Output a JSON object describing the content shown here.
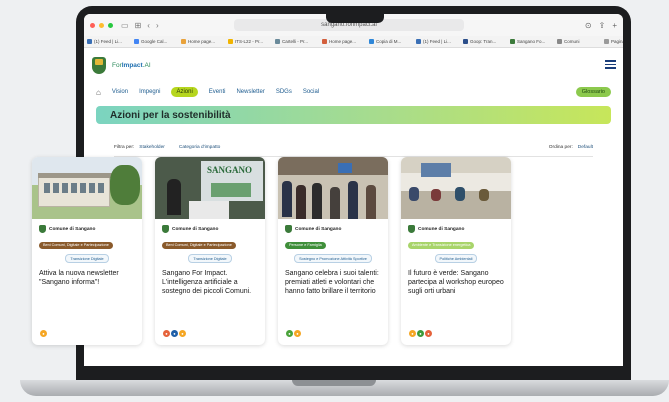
{
  "browser": {
    "url": "sangano.forimpact.ai",
    "bookmarks": [
      "(1) Feed | Li...",
      "Google Cal...",
      "Home page...",
      "ITS-L22 - Pr...",
      "Cartelli - Pr...",
      "Home page...",
      "Copia di M...",
      "(1) Feed | Li...",
      "Goop: Tran...",
      "Sangano Fo...",
      "Comuni",
      "Pagina d..."
    ],
    "bookmark_colors": [
      "#3a6fb5",
      "#4285f4",
      "#e9a23b",
      "#f1b400",
      "#6a8a9a",
      "#d35f3c",
      "#2f87d8",
      "#3a6fb5",
      "#2b4e8a",
      "#3b7a3a",
      "#888888",
      "#9a9a9a"
    ]
  },
  "site": {
    "brand_prefix": "For",
    "brand_main": "Impact",
    "brand_suffix": ".AI"
  },
  "nav": {
    "items": [
      "Vision",
      "Impegni",
      "Azioni",
      "Eventi",
      "Newsletter",
      "SDGs",
      "Social"
    ],
    "active": "Azioni",
    "glossary": "Glossario"
  },
  "page": {
    "title": "Azioni per la sostenibilità"
  },
  "filters": {
    "label": "Filtra per:",
    "stakeholder": "Stakeholder",
    "category": "Categoria d'impatto",
    "sort_label": "Ordina per:",
    "sort_value": "Default"
  },
  "cards": [
    {
      "org": "Comune di Sangano",
      "tag1": "Beni Comuni, Digitale e Partecipazione",
      "tag1_color": "#8a5a2b",
      "tag2": "Transizione Digitale",
      "title": "Attiva la nuova newsletter \"Sangano informa\"!",
      "sdg_colors": [
        "#f5a623"
      ]
    },
    {
      "org": "Comune di Sangano",
      "tag1": "Beni Comuni, Digitale e Partecipazione",
      "tag1_color": "#8a5a2b",
      "tag2": "Transizione Digitale",
      "title": "Sangano For Impact. L'intelligenza artificiale a sostegno dei piccoli Comuni.",
      "sdg_colors": [
        "#e5623a",
        "#1f5fa8",
        "#f5a623"
      ]
    },
    {
      "org": "Comune di Sangano",
      "tag1": "Persone e Famiglia",
      "tag1_color": "#3f8f3a",
      "tag2": "Sostegno e Promozione Attività Sportive",
      "title": "Sangano celebra i suoi talenti: premiati atleti e volontari che hanno fatto brillare il territorio",
      "sdg_colors": [
        "#4aa33a",
        "#f5a623"
      ]
    },
    {
      "org": "Comune di Sangano",
      "tag1": "Ambiente e Transizione energetica",
      "tag1_color": "#a8d46a",
      "tag2": "Politiche Ambientali",
      "title": "Il futuro è verde: Sangano partecipa al workshop europeo sugli orti urbani",
      "sdg_colors": [
        "#f5a623",
        "#3e9a3a",
        "#e5623a"
      ]
    }
  ]
}
